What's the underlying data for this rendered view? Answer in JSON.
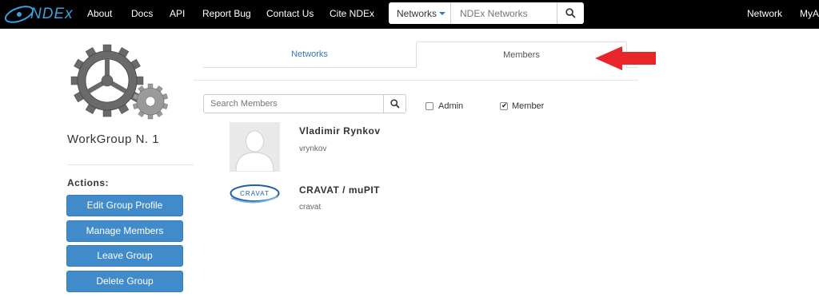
{
  "navbar": {
    "brand": "NDEx",
    "links": [
      {
        "label": "About"
      },
      {
        "label": "Docs"
      },
      {
        "label": "API"
      },
      {
        "label": "Report Bug"
      },
      {
        "label": "Contact Us"
      },
      {
        "label": "Cite NDEx"
      }
    ],
    "search": {
      "dropdown_label": "Networks",
      "placeholder": "NDEx Networks"
    },
    "right_links": [
      {
        "label": "Network"
      },
      {
        "label": "MyA"
      }
    ]
  },
  "sidebar": {
    "group_name": "WorkGroup N. 1",
    "actions_title": "Actions:",
    "actions": [
      {
        "label": "Edit Group Profile"
      },
      {
        "label": "Manage Members"
      },
      {
        "label": "Leave Group"
      },
      {
        "label": "Delete Group"
      }
    ]
  },
  "tabs": [
    {
      "label": "Networks",
      "active": false
    },
    {
      "label": "Members",
      "active": true
    }
  ],
  "members_panel": {
    "search_placeholder": "Search Members",
    "filters": [
      {
        "label": "Admin",
        "checked": false
      },
      {
        "label": "Member",
        "checked": true
      }
    ],
    "members": [
      {
        "name": "Vladimir Rynkov",
        "username": "vrynkov",
        "avatar": "default-user"
      },
      {
        "name": "CRAVAT / muPIT",
        "username": "cravat",
        "avatar": "cravat-logo",
        "avatar_text": "CRAVAT"
      }
    ]
  },
  "colors": {
    "navbar_bg": "#000000",
    "brand": "#3aa0e0",
    "primary_button": "#428bca",
    "link": "#337ab7",
    "annotation_arrow": "#e8262a"
  }
}
